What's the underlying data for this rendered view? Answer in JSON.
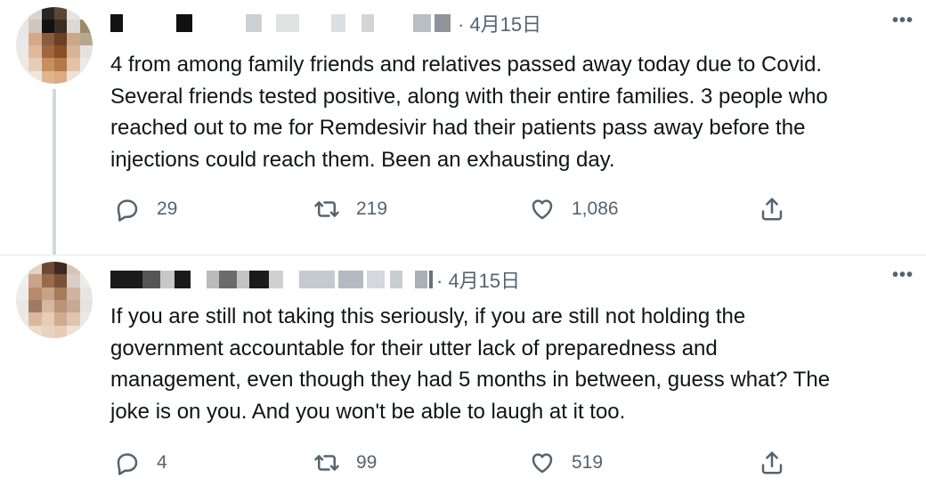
{
  "tweets": [
    {
      "date": "· 4月15日",
      "text": "4 from among family friends and relatives passed away today due to Covid.\nSeveral friends tested positive, along with their entire families. 3 people who\nreached out to me for Remdesivir had their patients pass away before the\ninjections could reach them. Been an exhausting day.",
      "more_icon": "•••",
      "reply_count": "29",
      "retweet_count": "219",
      "like_count": "1,086"
    },
    {
      "date": "· 4月15日",
      "text": "If you are still not taking this seriously, if you are still not holding the\ngovernment accountable for their utter lack of preparedness and\nmanagement, even though they had 5 months in between, guess what? The\njoke is on you. And you won't be able to laugh at it too.",
      "more_icon": "•••",
      "reply_count": "4",
      "retweet_count": "99",
      "like_count": "519"
    }
  ],
  "icons": {
    "reply": "reply-icon",
    "retweet": "retweet-icon",
    "like": "heart-icon",
    "share": "share-icon"
  },
  "colors": {
    "text": "#0f1419",
    "secondary": "#536471",
    "thread_line": "#cfd9de"
  }
}
